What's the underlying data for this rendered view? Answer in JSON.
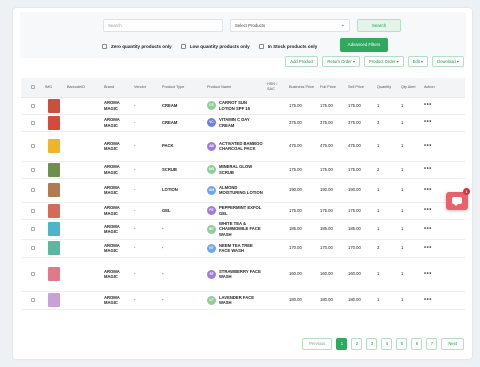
{
  "filters": {
    "search_placeholder": "Search",
    "select_value": "Select Products",
    "search_button": "Search",
    "zero_qty_label": "Zero quantity products only",
    "low_qty_label": "Low quantity products only",
    "in_stock_label": "In Stock products only",
    "advanced_button": "Advanced Filters"
  },
  "toolbar": {
    "add_product": "Add Product",
    "return_order": "Return Order ▾",
    "product_order": "Product Order ▾",
    "edit": "Edit ▾",
    "download": "Download ▾"
  },
  "table": {
    "headers": {
      "img": "IMG",
      "barcode": "BarcodeID",
      "brand": "Brand",
      "vendor": "Vendor",
      "product_type": "Product Type",
      "product_name": "Product Name",
      "hsn": "HSN / SAC",
      "business_price": "Business Price",
      "full_price": "Full Price",
      "sell_price": "Sell Price",
      "quantity": "Quantity",
      "qty_alert": "Qty Alert",
      "action": "Action"
    },
    "rows": [
      {
        "brand": "AROMA MAGIC",
        "vendor": "-",
        "type": "CREAM",
        "initials": "CS",
        "name": "CARROT SUN LOTION SPF 15",
        "business_price": "175.00",
        "full_price": "175.00",
        "sell_price": "175.00",
        "quantity": "1",
        "qty_alert": "1"
      },
      {
        "brand": "AROMA MAGIC",
        "vendor": "-",
        "type": "CREAM",
        "initials": "VC",
        "name": "VITAMIN C DAY CREAM",
        "business_price": "375.00",
        "full_price": "375.00",
        "sell_price": "375.00",
        "quantity": "3",
        "qty_alert": "1"
      },
      {
        "brand": "AROMA MAGIC",
        "vendor": "-",
        "type": "PACK",
        "initials": "AB",
        "name": "ACTIVATED BAMBOO CHARCOAL PACK",
        "business_price": "475.00",
        "full_price": "475.00",
        "sell_price": "475.00",
        "quantity": "1",
        "qty_alert": "1"
      },
      {
        "brand": "AROMA MAGIC",
        "vendor": "-",
        "type": "SCRUB",
        "initials": "MG",
        "name": "MINERAL GLOW SCRUB",
        "business_price": "175.00",
        "full_price": "175.00",
        "sell_price": "175.00",
        "quantity": "2",
        "qty_alert": "1"
      },
      {
        "brand": "AROMA MAGIC",
        "vendor": "-",
        "type": "LOTION",
        "initials": "AM",
        "name": "ALMOND MOISTURING LOTION",
        "business_price": "190.00",
        "full_price": "190.00",
        "sell_price": "190.00",
        "quantity": "1",
        "qty_alert": "1"
      },
      {
        "brand": "AROMA MAGIC",
        "vendor": "-",
        "type": "GEL",
        "initials": "PE",
        "name": "PEPPERMINT EXFOL GEL",
        "business_price": "175.00",
        "full_price": "175.00",
        "sell_price": "175.00",
        "quantity": "1",
        "qty_alert": "1"
      },
      {
        "brand": "AROMA MAGIC",
        "vendor": "-",
        "type": "-",
        "initials": "WT",
        "name": "WHITE TEA & CHAMMOMILE FACE WASH",
        "business_price": "185.00",
        "full_price": "185.00",
        "sell_price": "185.00",
        "quantity": "1",
        "qty_alert": "1"
      },
      {
        "brand": "AROMA MAGIC",
        "vendor": "-",
        "type": "-",
        "initials": "NT",
        "name": "NEEM TEA TREE FACE WASH",
        "business_price": "170.00",
        "full_price": "170.00",
        "sell_price": "170.00",
        "quantity": "3",
        "qty_alert": "1"
      },
      {
        "brand": "AROMA MAGIC",
        "vendor": "-",
        "type": "-",
        "initials": "SF",
        "name": "STRAWBERRY FACE WASH",
        "business_price": "160.00",
        "full_price": "160.00",
        "sell_price": "160.00",
        "quantity": "1",
        "qty_alert": "1"
      },
      {
        "brand": "AROMA MAGIC",
        "vendor": "-",
        "type": "-",
        "initials": "LF",
        "name": "LAVENDER FACE WASH",
        "business_price": "180.00",
        "full_price": "180.00",
        "sell_price": "180.00",
        "quantity": "1",
        "qty_alert": "1"
      }
    ]
  },
  "pagination": {
    "prev": "Previous",
    "pages": [
      "1",
      "2",
      "3",
      "4",
      "5",
      "6",
      "7"
    ],
    "active_page": "1",
    "next": "Next"
  },
  "chat": {
    "badge_count": "1"
  },
  "colors": {
    "accent_green": "#2fa95f",
    "avatar_colors": [
      "#8fce9a",
      "#6f7fe0",
      "#a07cd6",
      "#8fce9a",
      "#6fa8e8",
      "#a07cd6",
      "#8fce9a",
      "#6fa8e8",
      "#a07cd6",
      "#8fce9a"
    ],
    "thumb_colors": [
      "#c9503d",
      "#d44a3c",
      "#f0b429",
      "#6e8f4d",
      "#b07a52",
      "#d46a5a",
      "#4fb3c9",
      "#5cb7a0",
      "#e07a8a",
      "#c9a0d8"
    ]
  }
}
